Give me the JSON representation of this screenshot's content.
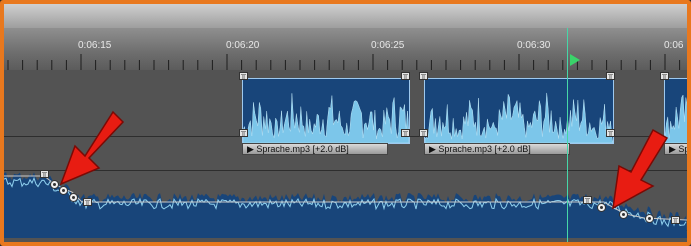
{
  "ruler": {
    "ticks": [
      "0:06:15",
      "0:06:20",
      "0:06:25",
      "0:06:30",
      "0:06"
    ]
  },
  "clips": [
    {
      "label": "Sprache.mp3 [+2.0 dB]"
    },
    {
      "label": "Sprache.mp3 [+2.0 dB]"
    },
    {
      "label": "Sp"
    }
  ],
  "colors": {
    "frame": "#e8781e",
    "waveform_fill": "#18457a",
    "waveform_line": "#8fd0ee",
    "playhead": "#46d7a8",
    "arrow": "#e81c12"
  }
}
